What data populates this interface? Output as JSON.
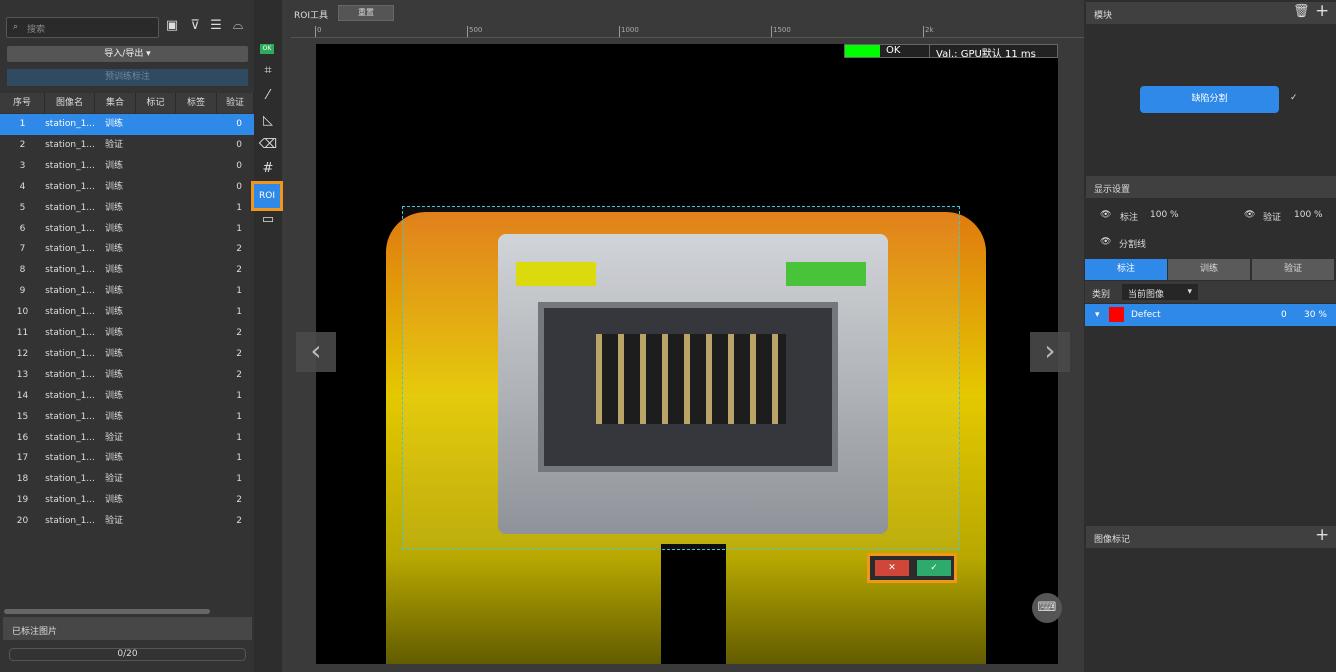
{
  "left": {
    "search_placeholder": "搜索",
    "import_export": "导入/导出 ▾",
    "pretrain_label": "预训练标注",
    "columns": [
      "序号",
      "图像名",
      "集合",
      "标记",
      "标签",
      "验证"
    ],
    "rows": [
      {
        "no": "1",
        "name": "station_1...",
        "set": "训练",
        "val": "0"
      },
      {
        "no": "2",
        "name": "station_1...",
        "set": "验证",
        "val": "0"
      },
      {
        "no": "3",
        "name": "station_1...",
        "set": "训练",
        "val": "0"
      },
      {
        "no": "4",
        "name": "station_1...",
        "set": "训练",
        "val": "0"
      },
      {
        "no": "5",
        "name": "station_1...",
        "set": "训练",
        "val": "1"
      },
      {
        "no": "6",
        "name": "station_1...",
        "set": "训练",
        "val": "1"
      },
      {
        "no": "7",
        "name": "station_1...",
        "set": "训练",
        "val": "2"
      },
      {
        "no": "8",
        "name": "station_1...",
        "set": "训练",
        "val": "2"
      },
      {
        "no": "9",
        "name": "station_1...",
        "set": "训练",
        "val": "1"
      },
      {
        "no": "10",
        "name": "station_1...",
        "set": "训练",
        "val": "1"
      },
      {
        "no": "11",
        "name": "station_1...",
        "set": "训练",
        "val": "2"
      },
      {
        "no": "12",
        "name": "station_1...",
        "set": "训练",
        "val": "2"
      },
      {
        "no": "13",
        "name": "station_1...",
        "set": "训练",
        "val": "2"
      },
      {
        "no": "14",
        "name": "station_1...",
        "set": "训练",
        "val": "1"
      },
      {
        "no": "15",
        "name": "station_1...",
        "set": "训练",
        "val": "1"
      },
      {
        "no": "16",
        "name": "station_1...",
        "set": "验证",
        "val": "1"
      },
      {
        "no": "17",
        "name": "station_1...",
        "set": "训练",
        "val": "1"
      },
      {
        "no": "18",
        "name": "station_1...",
        "set": "验证",
        "val": "1"
      },
      {
        "no": "19",
        "name": "station_1...",
        "set": "训练",
        "val": "2"
      },
      {
        "no": "20",
        "name": "station_1...",
        "set": "验证",
        "val": "2"
      }
    ],
    "annotated_label": "已标注图片",
    "progress": "0/20"
  },
  "tools": {
    "ok_badge": "OK",
    "roi": "ROI"
  },
  "center": {
    "tool_label": "ROI工具",
    "reset": "重置",
    "ruler": [
      "0",
      "500",
      "1000",
      "1500",
      "2k"
    ],
    "result": "OK",
    "val_info": "Val.: GPU默认 11 ms",
    "ok_color": "#00ff00"
  },
  "right": {
    "module_title": "模块",
    "module_node": "缺陷分割",
    "display_title": "显示设置",
    "annot_label": "标注",
    "annot_pct": "100 %",
    "valid_label": "验证",
    "valid_pct": "100 %",
    "seg_line": "分割线",
    "tabs": [
      "标注",
      "训练",
      "验证"
    ],
    "category_label": "类别",
    "category_value": "当前图像",
    "class": {
      "name": "Defect",
      "count": "0",
      "opacity": "30 %",
      "color": "#ff0000"
    },
    "image_tags": "图像标记"
  },
  "accent": "#2e89e8",
  "highlight": "#f0961e"
}
